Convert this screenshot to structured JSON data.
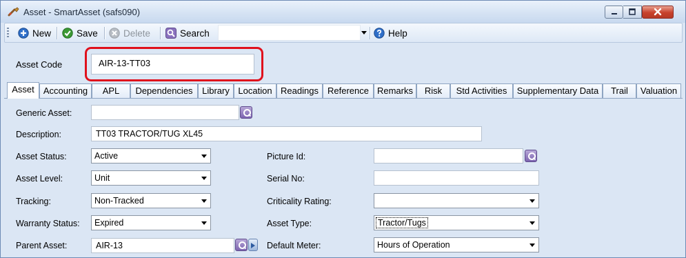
{
  "window": {
    "title": "Asset - SmartAsset (safs090)"
  },
  "toolbar": {
    "new_label": "New",
    "save_label": "Save",
    "delete_label": "Delete",
    "search_label": "Search",
    "help_label": "Help"
  },
  "header": {
    "asset_code_label": "Asset Code",
    "asset_code_value": "AIR-13-TT03"
  },
  "tabs": [
    {
      "label": "Asset"
    },
    {
      "label": "Accounting"
    },
    {
      "label": "APL"
    },
    {
      "label": "Dependencies"
    },
    {
      "label": "Library"
    },
    {
      "label": "Location"
    },
    {
      "label": "Readings"
    },
    {
      "label": "Reference"
    },
    {
      "label": "Remarks"
    },
    {
      "label": "Risk"
    },
    {
      "label": "Std Activities"
    },
    {
      "label": "Supplementary Data"
    },
    {
      "label": "Trail"
    },
    {
      "label": "Valuation"
    }
  ],
  "form": {
    "generic_asset_label": "Generic Asset:",
    "generic_asset_value": "",
    "description_label": "Description:",
    "description_value": "TT03 TRACTOR/TUG XL45",
    "asset_status_label": "Asset Status:",
    "asset_status_value": "Active",
    "asset_level_label": "Asset Level:",
    "asset_level_value": "Unit",
    "tracking_label": "Tracking:",
    "tracking_value": "Non-Tracked",
    "warranty_status_label": "Warranty Status:",
    "warranty_status_value": "Expired",
    "parent_asset_label": "Parent Asset:",
    "parent_asset_value": "AIR-13",
    "picture_id_label": "Picture Id:",
    "picture_id_value": "",
    "serial_no_label": "Serial No:",
    "serial_no_value": "",
    "criticality_rating_label": "Criticality Rating:",
    "criticality_rating_value": "",
    "asset_type_label": "Asset Type:",
    "asset_type_value": "Tractor/Tugs",
    "default_meter_label": "Default Meter:",
    "default_meter_value": "Hours of Operation"
  },
  "colors": {
    "highlight": "#e0101c",
    "window_bg": "#dbe6f4",
    "close_button": "#c8412c"
  },
  "icons": {
    "title": "wrench-app-icon",
    "new": "plus-circle-icon",
    "save": "checkmark-circle-icon",
    "delete": "x-circle-icon",
    "search": "magnifier-icon",
    "help": "question-circle-icon",
    "lookup": "lookup-magnifier-icon",
    "goto": "goto-arrow-icon"
  }
}
